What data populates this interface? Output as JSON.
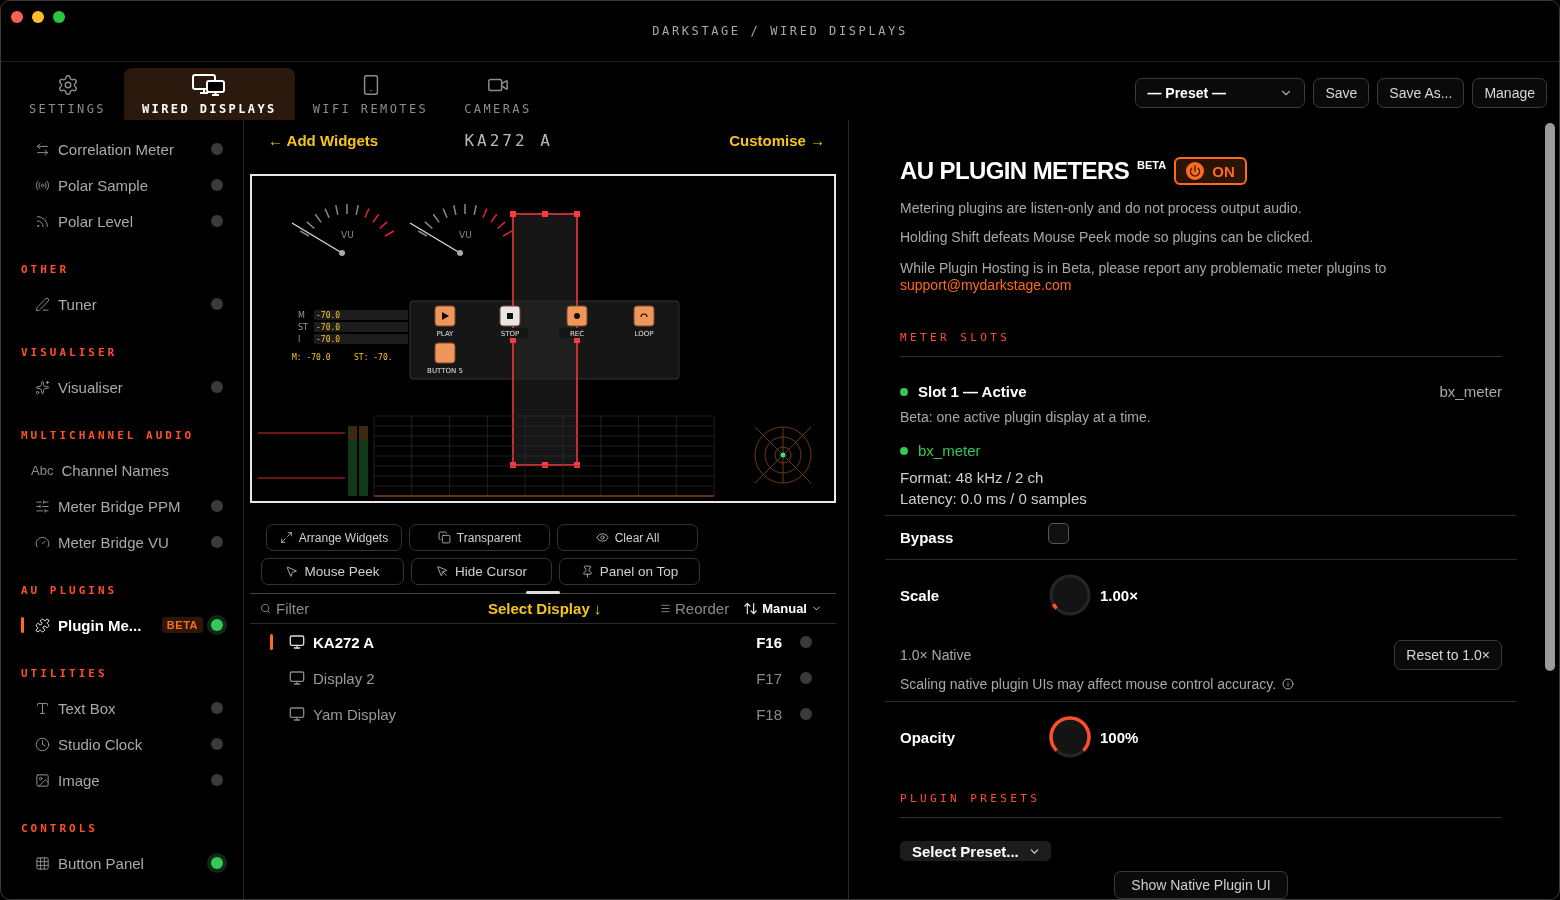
{
  "window": {
    "title": "DARKSTAGE / WIRED DISPLAYS"
  },
  "tabs": [
    {
      "label": "SETTINGS",
      "kind": "gear",
      "selected": false
    },
    {
      "label": "WIRED DISPLAYS",
      "kind": "displays",
      "selected": true
    },
    {
      "label": "WIFI REMOTES",
      "kind": "phone",
      "selected": false
    },
    {
      "label": "CAMERAS",
      "kind": "camera",
      "selected": false
    }
  ],
  "toolbar": {
    "preset": "— Preset —",
    "buttons": [
      "Save",
      "Save As...",
      "Manage"
    ]
  },
  "sidebar": {
    "sections": [
      {
        "items": [
          {
            "label": "Correlation Meter",
            "kind": "arrows",
            "toggle": {
              "on": false
            },
            "selected": false
          },
          {
            "label": "Polar Sample",
            "kind": "radio",
            "toggle": {
              "on": false
            },
            "selected": false
          },
          {
            "label": "Polar Level",
            "kind": "rss",
            "toggle": {
              "on": false
            },
            "selected": false
          }
        ]
      },
      {
        "heading": "OTHER",
        "items": [
          {
            "label": "Tuner",
            "kind": "pen",
            "toggle": {
              "on": false
            },
            "selected": false
          }
        ]
      },
      {
        "heading": "VISUALISER",
        "items": [
          {
            "label": "Visualiser",
            "kind": "sparkles",
            "toggle": {
              "on": false
            },
            "selected": false
          }
        ]
      },
      {
        "heading": "MULTICHANNEL AUDIO",
        "items": [
          {
            "label": "Channel Names",
            "kind": "text",
            "icon_text": "Abc",
            "selected": false
          },
          {
            "label": "Meter Bridge PPM",
            "kind": "sliders",
            "toggle": {
              "on": false
            },
            "selected": false
          },
          {
            "label": "Meter Bridge VU",
            "kind": "gauge",
            "toggle": {
              "on": false
            },
            "selected": false
          }
        ]
      },
      {
        "heading": "AU PLUGINS",
        "items": [
          {
            "label": "Plugin Me...",
            "kind": "puzzle",
            "badge": "BETA",
            "toggle": {
              "on": true
            },
            "selected": true
          }
        ]
      },
      {
        "heading": "UTILITIES",
        "items": [
          {
            "label": "Text Box",
            "kind": "type",
            "toggle": {
              "on": false
            },
            "selected": false
          },
          {
            "label": "Studio Clock",
            "kind": "clock",
            "toggle": {
              "on": false
            },
            "selected": false
          },
          {
            "label": "Image",
            "kind": "image",
            "toggle": {
              "on": false
            },
            "selected": false
          }
        ]
      },
      {
        "heading": "CONTROLS",
        "items": [
          {
            "label": "Button Panel",
            "kind": "grid",
            "toggle": {
              "on": true
            },
            "selected": false
          }
        ]
      }
    ]
  },
  "display": {
    "back_link": "← Add Widgets",
    "title": "KA272 A",
    "forward_link": "Customise →",
    "preview": {
      "vu_meters": [
        {
          "label": "VU"
        },
        {
          "label": "VU"
        }
      ],
      "loudness": {
        "rows": [
          {
            "label": "M",
            "value": "-70.0"
          },
          {
            "label": "ST",
            "value": "-70.0"
          },
          {
            "label": "I",
            "value": "-70.0"
          }
        ],
        "readouts": [
          "M: -70.0",
          "ST: -70."
        ]
      },
      "buttons": [
        {
          "label": "PLAY",
          "kind": "play",
          "active": false
        },
        {
          "label": "STOP",
          "kind": "stop",
          "active": true
        },
        {
          "label": "REC",
          "kind": "rec",
          "active": false
        },
        {
          "label": "LOOP",
          "kind": "loop",
          "active": false
        },
        {
          "label": "BUTTON 5",
          "kind": "blank",
          "active": false
        }
      ]
    },
    "actions": [
      [
        {
          "label": "Arrange Widgets",
          "kind": "arrange"
        },
        {
          "label": "Transparent",
          "kind": "copy"
        },
        {
          "label": "Clear All",
          "kind": "eye"
        }
      ],
      [
        {
          "label": "Mouse Peek",
          "kind": "pointer"
        },
        {
          "label": "Hide Cursor",
          "kind": "pointer-off"
        },
        {
          "label": "Panel on Top",
          "kind": "pin"
        }
      ]
    ],
    "list_toolbar": {
      "filter": {
        "placeholder": "Filter"
      },
      "select": "Select Display ↓",
      "reorder": "Reorder",
      "sort": "Manual"
    },
    "displays": [
      {
        "name": "KA272 A",
        "key": "F16",
        "selected": true,
        "active": false
      },
      {
        "name": "Display 2",
        "key": "F17",
        "selected": false,
        "active": false
      },
      {
        "name": "Yam Display",
        "key": "F18",
        "selected": false,
        "active": false
      }
    ]
  },
  "plugin": {
    "title": "AU PLUGIN METERS",
    "badge": "BETA",
    "power": {
      "label": "ON",
      "on": true
    },
    "paragraphs": [
      "Metering plugins are listen-only and do not process output audio.",
      "Holding Shift defeats Mouse Peek mode so plugins can be clicked.",
      "While Plugin Hosting is in Beta, please report any problematic meter plugins to"
    ],
    "email": "support@mydarkstage.com",
    "slots_heading": "METER SLOTS",
    "slot": {
      "title": "Slot 1 — Active",
      "plugin": "bx_meter",
      "color": "#34c759",
      "note": "Beta: one active plugin display at a time.",
      "plugin_name": "bx_meter",
      "format": "Format: 48 kHz / 2 ch",
      "latency": "Latency: 0.0 ms / 0 samples"
    },
    "bypass": {
      "label": "Bypass",
      "checked": false
    },
    "scale": {
      "label": "Scale",
      "level": 0.06,
      "reading": "1.00×",
      "native": "1.0× Native",
      "reset": "Reset to 1.0×",
      "note": "Scaling native plugin UIs may affect mouse control accuracy."
    },
    "opacity": {
      "label": "Opacity",
      "level": 1,
      "reading": "100%"
    },
    "presets_heading": "PLUGIN PRESETS",
    "preset_select": "Select Preset...",
    "show_button": "Show Native Plugin UI"
  }
}
